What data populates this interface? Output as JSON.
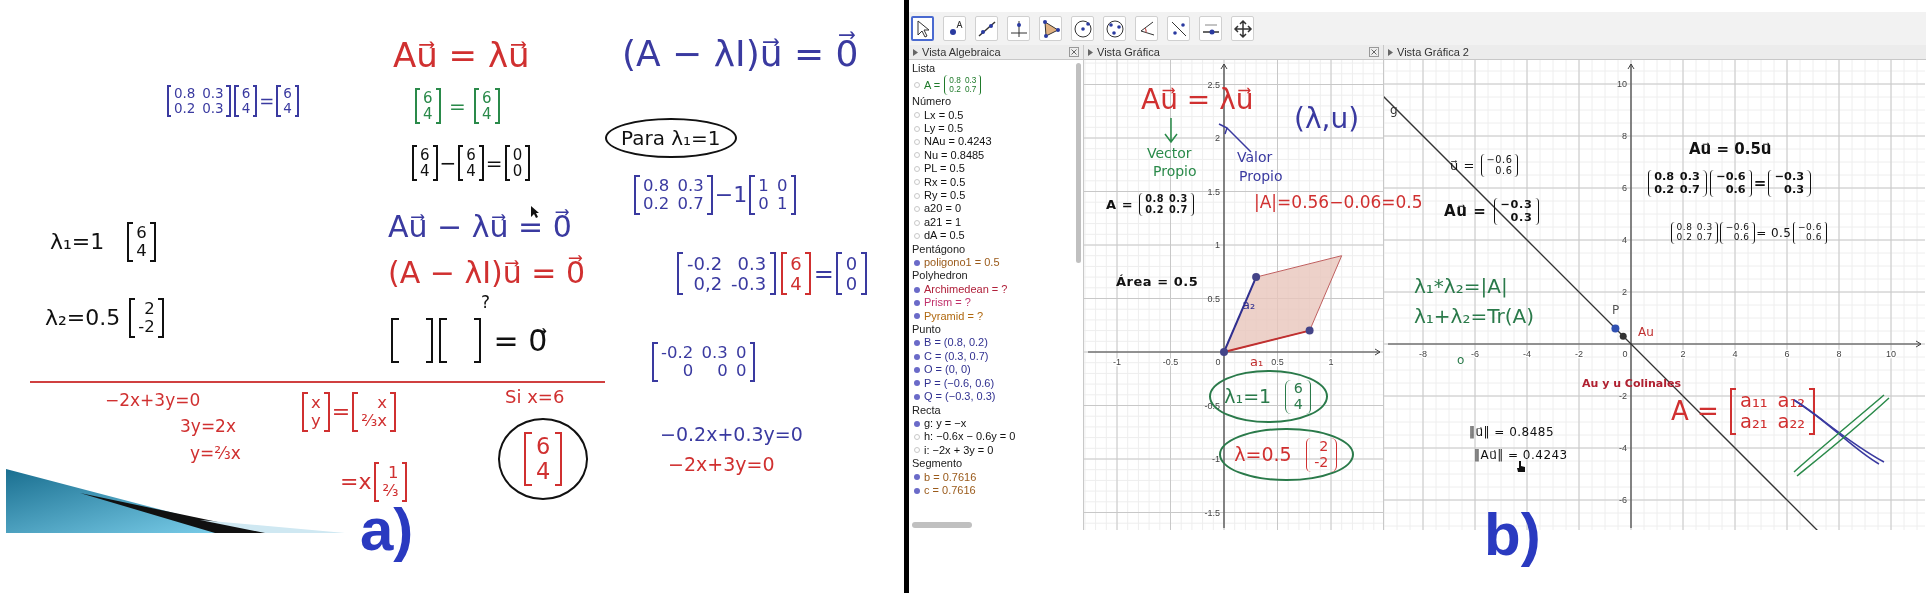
{
  "whiteboard": {
    "notes": [
      {
        "color": "#3a3aa0",
        "circled": false,
        "parts": [
          {
            "kind": "bmatrix",
            "rows": [
              [
                "0.8",
                "0.3"
              ],
              [
                "0.2",
                "0.3"
              ]
            ]
          },
          {
            "kind": "bmatrix",
            "rows": [
              [
                "6"
              ],
              [
                "4"
              ]
            ]
          },
          {
            "kind": "text",
            "text": "="
          },
          {
            "kind": "bmatrix",
            "rows": [
              [
                "6"
              ],
              [
                "4"
              ]
            ]
          }
        ]
      },
      {
        "color": "#d03030",
        "circled": false,
        "parts": [
          {
            "kind": "text",
            "text": "Au⃗ = λu⃗"
          }
        ]
      },
      {
        "color": "#2a8a4a",
        "circled": false,
        "parts": [
          {
            "kind": "bmatrix",
            "rows": [
              [
                "6"
              ],
              [
                "4"
              ]
            ]
          },
          {
            "kind": "text",
            "text": " = "
          },
          {
            "kind": "bmatrix",
            "rows": [
              [
                "6"
              ],
              [
                "4"
              ]
            ]
          }
        ]
      },
      {
        "color": "#111111",
        "circled": false,
        "parts": [
          {
            "kind": "bmatrix",
            "rows": [
              [
                "6"
              ],
              [
                "4"
              ]
            ]
          },
          {
            "kind": "text",
            "text": "−"
          },
          {
            "kind": "bmatrix",
            "rows": [
              [
                "6"
              ],
              [
                "4"
              ]
            ]
          },
          {
            "kind": "text",
            "text": "="
          },
          {
            "kind": "bmatrix",
            "rows": [
              [
                "0"
              ],
              [
                "0"
              ]
            ]
          }
        ]
      },
      {
        "color": "#3a3aa0",
        "circled": false,
        "parts": [
          {
            "kind": "text",
            "text": "Au⃗ − λu⃗ = 0⃗"
          }
        ]
      },
      {
        "color": "#d03030",
        "circled": false,
        "parts": [
          {
            "kind": "text",
            "text": "(A − λI)u⃗ = 0⃗"
          }
        ]
      },
      {
        "color": "#111111",
        "circled": false,
        "parts": [
          {
            "kind": "text",
            "text": "?"
          }
        ]
      },
      {
        "color": "#111111",
        "circled": false,
        "parts": [
          {
            "kind": "blank"
          },
          {
            "kind": "blank"
          },
          {
            "kind": "text",
            "text": " = 0⃗"
          }
        ]
      },
      {
        "color": "#111111",
        "circled": false,
        "parts": [
          {
            "kind": "text",
            "text": "λ₁=1   "
          },
          {
            "kind": "bmatrix",
            "rows": [
              [
                "6"
              ],
              [
                "4"
              ]
            ]
          }
        ]
      },
      {
        "color": "#111111",
        "circled": false,
        "parts": [
          {
            "kind": "text",
            "text": "λ₂=0.5 "
          },
          {
            "kind": "bmatrix",
            "rows": [
              [
                "2"
              ],
              [
                "-2"
              ]
            ]
          }
        ]
      },
      {
        "color": "#d03030",
        "circled": false,
        "parts": [
          {
            "kind": "text",
            "text": "−2x+3y=0"
          }
        ]
      },
      {
        "color": "#d03030",
        "circled": false,
        "parts": [
          {
            "kind": "text",
            "text": "3y=2x"
          }
        ]
      },
      {
        "color": "#d03030",
        "circled": false,
        "parts": [
          {
            "kind": "text",
            "text": "y=⅔x"
          }
        ]
      },
      {
        "color": "#d03030",
        "circled": false,
        "parts": [
          {
            "kind": "bmatrix",
            "rows": [
              [
                "x"
              ],
              [
                "y"
              ]
            ]
          },
          {
            "kind": "text",
            "text": "="
          },
          {
            "kind": "bmatrix",
            "rows": [
              [
                "x"
              ],
              [
                "⅔x"
              ]
            ]
          }
        ]
      },
      {
        "color": "#d03030",
        "circled": false,
        "parts": [
          {
            "kind": "text",
            "text": "=x"
          },
          {
            "kind": "bmatrix",
            "rows": [
              [
                "1"
              ],
              [
                "⅔"
              ]
            ]
          }
        ]
      },
      {
        "color": "#d03030",
        "circled": false,
        "parts": [
          {
            "kind": "text",
            "text": "Si x=6"
          }
        ]
      },
      {
        "color": "#d03030",
        "circled": true,
        "parts": [
          {
            "kind": "bmatrix",
            "rows": [
              [
                "6"
              ],
              [
                "4"
              ]
            ]
          }
        ]
      },
      {
        "color": "#3a3aa0",
        "circled": false,
        "parts": [
          {
            "kind": "text",
            "text": "(A − λI)u⃗ = 0⃗"
          }
        ]
      },
      {
        "color": "#111111",
        "circled": true,
        "parts": [
          {
            "kind": "text",
            "text": "Para λ₁=1"
          }
        ]
      },
      {
        "color": "#3a3aa0",
        "circled": false,
        "parts": [
          {
            "kind": "bmatrix",
            "rows": [
              [
                "0.8",
                "0.3"
              ],
              [
                "0.2",
                "0.7"
              ]
            ]
          },
          {
            "kind": "text",
            "text": "−1"
          },
          {
            "kind": "bmatrix",
            "rows": [
              [
                "1",
                "0"
              ],
              [
                "0",
                "1"
              ]
            ]
          }
        ]
      },
      {
        "color": "#3a3aa0",
        "circled": false,
        "parts": [
          {
            "kind": "bmatrix",
            "rows": [
              [
                "-0.2",
                "0.3"
              ],
              [
                "0,2",
                "-0.3"
              ]
            ]
          },
          {
            "kind": "bmatrix",
            "color": "#d03030",
            "rows": [
              [
                "6"
              ],
              [
                "4"
              ]
            ]
          },
          {
            "kind": "text",
            "text": "="
          },
          {
            "kind": "bmatrix",
            "rows": [
              [
                "0"
              ],
              [
                "0"
              ]
            ]
          }
        ]
      },
      {
        "color": "#3a3aa0",
        "circled": false,
        "parts": [
          {
            "kind": "bmatrix",
            "rows": [
              [
                "-0.2",
                "0.3",
                "0"
              ],
              [
                "0",
                "0",
                "0"
              ]
            ]
          }
        ]
      },
      {
        "color": "#3a3aa0",
        "circled": false,
        "parts": [
          {
            "kind": "text",
            "text": "−0.2x+0.3y=0"
          }
        ]
      },
      {
        "color": "#d03030",
        "circled": false,
        "parts": [
          {
            "kind": "text",
            "text": "−2x+3y=0"
          }
        ]
      }
    ],
    "caption": "a)"
  },
  "geogebra": {
    "tools": [
      {
        "kind": "move",
        "selected": true
      },
      {
        "kind": "point",
        "selected": false
      },
      {
        "kind": "line",
        "selected": false
      },
      {
        "kind": "perpendicular",
        "selected": false
      },
      {
        "kind": "polygon",
        "selected": false
      },
      {
        "kind": "circle",
        "selected": false
      },
      {
        "kind": "conic",
        "selected": false
      },
      {
        "kind": "angle",
        "selected": false
      },
      {
        "kind": "reflect",
        "selected": false
      },
      {
        "kind": "slider",
        "selected": false
      },
      {
        "kind": "move_view",
        "selected": false
      }
    ],
    "algebra": {
      "title": "Vista Algebraica",
      "groups": [
        {
          "title": "Lista",
          "items": [
            {
              "visible": false,
              "color": "#1f7a2a",
              "parts": [
                {
                  "kind": "text",
                  "text": "A = "
                },
                {
                  "kind": "pmatrix",
                  "rows": [
                    [
                      "0.8",
                      "0.3"
                    ],
                    [
                      "0.2",
                      "0.7"
                    ]
                  ]
                }
              ]
            }
          ]
        },
        {
          "title": "Número",
          "items": [
            {
              "visible": false,
              "color": "#111111",
              "parts": [
                {
                  "kind": "text",
                  "text": "Lx = 0.5"
                }
              ]
            },
            {
              "visible": false,
              "color": "#111111",
              "parts": [
                {
                  "kind": "text",
                  "text": "Ly = 0.5"
                }
              ]
            },
            {
              "visible": false,
              "color": "#111111",
              "parts": [
                {
                  "kind": "text",
                  "text": "NAu = 0.4243"
                }
              ]
            },
            {
              "visible": false,
              "color": "#111111",
              "parts": [
                {
                  "kind": "text",
                  "text": "Nu = 0.8485"
                }
              ]
            },
            {
              "visible": false,
              "color": "#111111",
              "parts": [
                {
                  "kind": "text",
                  "text": "PL = 0.5"
                }
              ]
            },
            {
              "visible": false,
              "color": "#111111",
              "parts": [
                {
                  "kind": "text",
                  "text": "Rx = 0.5"
                }
              ]
            },
            {
              "visible": false,
              "color": "#111111",
              "parts": [
                {
                  "kind": "text",
                  "text": "Ry = 0.5"
                }
              ]
            },
            {
              "visible": false,
              "color": "#111111",
              "parts": [
                {
                  "kind": "text",
                  "text": "a20 = 0"
                }
              ]
            },
            {
              "visible": false,
              "color": "#111111",
              "parts": [
                {
                  "kind": "text",
                  "text": "a21 = 1"
                }
              ]
            },
            {
              "visible": false,
              "color": "#111111",
              "parts": [
                {
                  "kind": "text",
                  "text": "dA = 0.5"
                }
              ]
            }
          ]
        },
        {
          "title": "Pentágono",
          "items": [
            {
              "visible": true,
              "color": "#9a5a1a",
              "parts": [
                {
                  "kind": "text",
                  "text": "poligono1 = 0.5"
                }
              ]
            }
          ]
        },
        {
          "title": "Polyhedron",
          "items": [
            {
              "visible": true,
              "color": "#b0203a",
              "parts": [
                {
                  "kind": "text",
                  "text": "Archimedean = ?"
                }
              ]
            },
            {
              "visible": true,
              "color": "#c0306a",
              "parts": [
                {
                  "kind": "text",
                  "text": "Prism = ?"
                }
              ]
            },
            {
              "visible": true,
              "color": "#b0680f",
              "parts": [
                {
                  "kind": "text",
                  "text": "Pyramid = ?"
                }
              ]
            }
          ]
        },
        {
          "title": "Punto",
          "items": [
            {
              "visible": true,
              "color": "#303090",
              "parts": [
                {
                  "kind": "text",
                  "text": "B = (0.8, 0.2)"
                }
              ]
            },
            {
              "visible": true,
              "color": "#303090",
              "parts": [
                {
                  "kind": "text",
                  "text": "C = (0.3, 0.7)"
                }
              ]
            },
            {
              "visible": true,
              "color": "#303090",
              "parts": [
                {
                  "kind": "text",
                  "text": "O = (0, 0)"
                }
              ]
            },
            {
              "visible": true,
              "color": "#303090",
              "parts": [
                {
                  "kind": "text",
                  "text": "P = (−0.6, 0.6)"
                }
              ]
            },
            {
              "visible": true,
              "color": "#303090",
              "parts": [
                {
                  "kind": "text",
                  "text": "Q = (−0.3, 0.3)"
                }
              ]
            }
          ]
        },
        {
          "title": "Recta",
          "items": [
            {
              "visible": true,
              "color": "#111111",
              "parts": [
                {
                  "kind": "text",
                  "text": "g: y = −x"
                }
              ]
            },
            {
              "visible": false,
              "color": "#111111",
              "parts": [
                {
                  "kind": "text",
                  "text": "h: −0.6x − 0.6y = 0"
                }
              ]
            },
            {
              "visible": false,
              "color": "#111111",
              "parts": [
                {
                  "kind": "text",
                  "text": "i: −2x + 3y = 0"
                }
              ]
            }
          ]
        },
        {
          "title": "Segmento",
          "items": [
            {
              "visible": true,
              "color": "#9a5a1a",
              "parts": [
                {
                  "kind": "text",
                  "text": "b = 0.7616"
                }
              ]
            },
            {
              "visible": true,
              "color": "#9a5a1a",
              "parts": [
                {
                  "kind": "text",
                  "text": "c = 0.7616"
                }
              ]
            }
          ]
        }
      ]
    },
    "graphics": [
      {
        "title": "Vista Gráfica",
        "x_ticks": [
          "-1",
          "-0.5",
          "0",
          "0.5",
          "1"
        ],
        "y_ticks": [
          "2.5",
          "2",
          "1.5",
          "1",
          "0.5",
          "-0.5",
          "-1",
          "-1.5"
        ],
        "objects": [
          {
            "kind": "math",
            "bold": true,
            "color": "#111111",
            "parts": [
              {
                "kind": "text",
                "text": "A = "
              },
              {
                "kind": "pmatrix",
                "rows": [
                  [
                    "0.8",
                    "0.3"
                  ],
                  [
                    "0.2",
                    "0.7"
                  ]
                ]
              }
            ]
          },
          {
            "kind": "math",
            "bold": true,
            "color": "#111111",
            "parts": [
              {
                "kind": "text",
                "text": "Área = 0.5"
              }
            ]
          },
          {
            "kind": "label",
            "bold": false,
            "color": "#c03030",
            "parts": [
              {
                "kind": "text",
                "text": "a₁"
              }
            ]
          },
          {
            "kind": "label",
            "bold": false,
            "color": "#303090",
            "parts": [
              {
                "kind": "text",
                "text": "a₂"
              }
            ]
          }
        ]
      },
      {
        "title": "Vista Gráfica 2",
        "x_ticks": [
          "-8",
          "-6",
          "-4",
          "-2",
          "0",
          "2",
          "4",
          "6",
          "8",
          "10"
        ],
        "y_ticks": [
          "10",
          "8",
          "6",
          "4",
          "2",
          "-2",
          "-4",
          "-6"
        ],
        "objects": [
          {
            "kind": "math",
            "bold": false,
            "color": "#111111",
            "parts": [
              {
                "kind": "text",
                "text": "u⃗ = "
              },
              {
                "kind": "pmatrix",
                "rows": [
                  [
                    "−0.6"
                  ],
                  [
                    "0.6"
                  ]
                ]
              }
            ]
          },
          {
            "kind": "math",
            "bold": true,
            "color": "#111111",
            "parts": [
              {
                "kind": "text",
                "text": "Au⃗ = "
              },
              {
                "kind": "pmatrix",
                "rows": [
                  [
                    "−0.3"
                  ],
                  [
                    "0.3"
                  ]
                ]
              }
            ]
          },
          {
            "kind": "label",
            "bold": true,
            "color": "#111111",
            "parts": [
              {
                "kind": "text",
                "text": "Au⃗ = 0.5u⃗"
              }
            ]
          },
          {
            "kind": "label",
            "bold": true,
            "color": "#111111",
            "parts": [
              {
                "kind": "pmatrix",
                "rows": [
                  [
                    "0.8",
                    "0.3"
                  ],
                  [
                    "0.2",
                    "0.7"
                  ]
                ]
              },
              {
                "kind": "pmatrix",
                "rows": [
                  [
                    "−0.6"
                  ],
                  [
                    "0.6"
                  ]
                ]
              },
              {
                "kind": "text",
                "text": "="
              },
              {
                "kind": "pmatrix",
                "rows": [
                  [
                    "−0.3"
                  ],
                  [
                    "0.3"
                  ]
                ]
              }
            ]
          },
          {
            "kind": "math",
            "bold": false,
            "color": "#111111",
            "parts": [
              {
                "kind": "pmatrix",
                "rows": [
                  [
                    "0.8",
                    "0.3"
                  ],
                  [
                    "0.2",
                    "0.7"
                  ]
                ]
              },
              {
                "kind": "pmatrix",
                "rows": [
                  [
                    "−0.6"
                  ],
                  [
                    "0.6"
                  ]
                ]
              },
              {
                "kind": "text",
                "text": "= 0.5"
              },
              {
                "kind": "pmatrix",
                "rows": [
                  [
                    "−0.6"
                  ],
                  [
                    "0.6"
                  ]
                ]
              }
            ]
          },
          {
            "kind": "math",
            "bold": false,
            "color": "#111111",
            "parts": [
              {
                "kind": "text",
                "text": "‖u⃗‖ = 0.8485"
              }
            ]
          },
          {
            "kind": "math",
            "bold": false,
            "color": "#111111",
            "parts": [
              {
                "kind": "text",
                "text": "‖Au⃗‖ = 0.4243"
              }
            ]
          },
          {
            "kind": "label",
            "bold": true,
            "color": "#b02030",
            "parts": [
              {
                "kind": "text",
                "text": "Au y u Colinales"
              }
            ]
          },
          {
            "kind": "label",
            "bold": false,
            "color": "#333333",
            "parts": [
              {
                "kind": "text",
                "text": "g"
              }
            ]
          },
          {
            "kind": "label",
            "bold": false,
            "color": "#555555",
            "parts": [
              {
                "kind": "text",
                "text": "P"
              }
            ]
          },
          {
            "kind": "label",
            "bold": false,
            "color": "#c03030",
            "parts": [
              {
                "kind": "text",
                "text": "Au"
              }
            ]
          }
        ]
      }
    ],
    "ink": [
      {
        "color": "#d03030",
        "circled": false,
        "parts": [
          {
            "kind": "text",
            "text": "Au⃗ = λu⃗"
          }
        ]
      },
      {
        "color": "#2a8a4a",
        "circled": false,
        "parts": [
          {
            "kind": "text",
            "text": "Vector"
          }
        ]
      },
      {
        "color": "#2a8a4a",
        "circled": false,
        "parts": [
          {
            "kind": "text",
            "text": "Propio"
          }
        ]
      },
      {
        "color": "#3a3aa0",
        "circled": false,
        "parts": [
          {
            "kind": "text",
            "text": "Valor"
          }
        ]
      },
      {
        "color": "#3a3aa0",
        "circled": false,
        "parts": [
          {
            "kind": "text",
            "text": "Propio"
          }
        ]
      },
      {
        "color": "#3a3aa0",
        "circled": false,
        "parts": [
          {
            "kind": "text",
            "text": "(λ,u)"
          }
        ]
      },
      {
        "color": "#d03030",
        "circled": false,
        "parts": [
          {
            "kind": "text",
            "text": "|A|=0.56−0.06=0.5"
          }
        ]
      },
      {
        "color": "#2a7a4a",
        "circled": true,
        "parts": [
          {
            "kind": "text",
            "text": "λ₁=1  "
          },
          {
            "kind": "pmatrix",
            "rows": [
              [
                "6"
              ],
              [
                "4"
              ]
            ]
          }
        ]
      },
      {
        "color": "#d03030",
        "circled": true,
        "parts": [
          {
            "kind": "text",
            "text": "λ=0.5  "
          },
          {
            "kind": "pmatrix",
            "rows": [
              [
                "2"
              ],
              [
                "-2"
              ]
            ]
          }
        ]
      },
      {
        "color": "#2a7a4a",
        "circled": false,
        "parts": [
          {
            "kind": "text",
            "text": "λ₁*λ₂=|A|"
          }
        ]
      },
      {
        "color": "#2a7a4a",
        "circled": false,
        "parts": [
          {
            "kind": "text",
            "text": "λ₁+λ₂=Tr(A)"
          }
        ]
      },
      {
        "color": "#2a7a4a",
        "circled": false,
        "parts": [
          {
            "kind": "text",
            "text": "o"
          }
        ]
      },
      {
        "color": "#d03030",
        "circled": false,
        "parts": [
          {
            "kind": "text",
            "text": "A = "
          },
          {
            "kind": "bmatrix",
            "rows": [
              [
                "a₁₁",
                "a₁₂"
              ],
              [
                "a₂₁",
                "a₂₂"
              ]
            ]
          }
        ]
      }
    ],
    "caption": "b)"
  }
}
